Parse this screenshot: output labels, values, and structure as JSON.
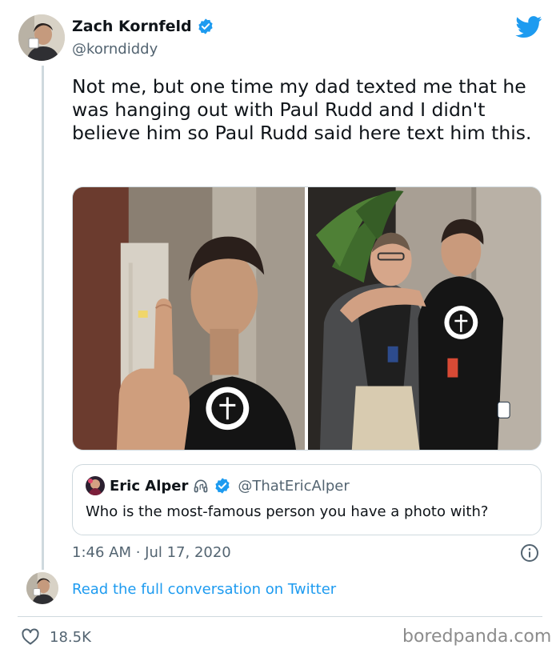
{
  "author": {
    "name": "Zach Kornfeld",
    "handle": "@korndiddy",
    "verified": true,
    "avatar_icon": "avatar-photo"
  },
  "tweet": {
    "text": "Not me, but one time my dad texted me that he was hanging out with Paul Rudd and I didn't believe him so Paul Rudd said here text him this.",
    "media": [
      {
        "icon": "photo-middle-finger"
      },
      {
        "icon": "photo-two-men"
      }
    ]
  },
  "quote": {
    "name": "Eric Alper",
    "handle": "@ThatEricAlper",
    "text": "Who is the most-famous person you have a photo with?",
    "icons": [
      "headphones-icon",
      "verified-icon"
    ]
  },
  "timestamp": "1:46 AM · Jul 17, 2020",
  "read_full": "Read the full conversation on Twitter",
  "likes": "18.5K",
  "watermark": "boredpanda.com",
  "colors": {
    "twitter_blue": "#1d9bf0",
    "secondary_text": "#536471",
    "border": "#cfd9de"
  }
}
